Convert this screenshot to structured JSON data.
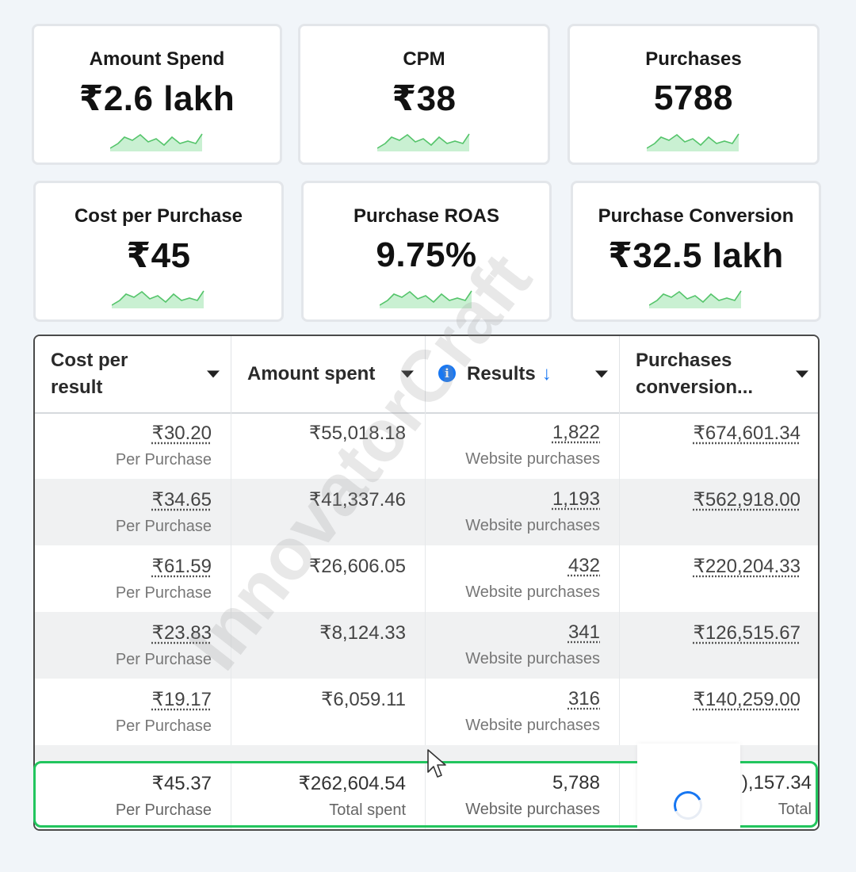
{
  "cards": [
    {
      "title": "Amount Spend",
      "value": "₹2.6 lakh"
    },
    {
      "title": "CPM",
      "value": "₹38"
    },
    {
      "title": "Purchases",
      "value": "5788"
    },
    {
      "title": "Cost per Purchase",
      "value": "₹45"
    },
    {
      "title": "Purchase ROAS",
      "value": "9.75%"
    },
    {
      "title": "Purchase Conversion",
      "value": "₹32.5 lakh"
    }
  ],
  "table": {
    "columns": [
      {
        "label": "Cost per result"
      },
      {
        "label": "Amount spent"
      },
      {
        "label": "Results",
        "sort_icon": "↓"
      },
      {
        "label": "Purchases conversion..."
      }
    ],
    "rows": [
      {
        "cost": "₹30.20",
        "cost_sub": "Per Purchase",
        "spent": "₹55,018.18",
        "results": "1,822",
        "results_sub": "Website purchases",
        "conv": "₹674,601.34"
      },
      {
        "cost": "₹34.65",
        "cost_sub": "Per Purchase",
        "spent": "₹41,337.46",
        "results": "1,193",
        "results_sub": "Website purchases",
        "conv": "₹562,918.00"
      },
      {
        "cost": "₹61.59",
        "cost_sub": "Per Purchase",
        "spent": "₹26,606.05",
        "results": "432",
        "results_sub": "Website purchases",
        "conv": "₹220,204.33"
      },
      {
        "cost": "₹23.83",
        "cost_sub": "Per Purchase",
        "spent": "₹8,124.33",
        "results": "341",
        "results_sub": "Website purchases",
        "conv": "₹126,515.67"
      },
      {
        "cost": "₹19.17",
        "cost_sub": "Per Purchase",
        "spent": "₹6,059.11",
        "results": "316",
        "results_sub": "Website purchases",
        "conv": "₹140,259.00"
      }
    ],
    "totals": {
      "cost": "₹45.37",
      "cost_sub": "Per Purchase",
      "spent": "₹262,604.54",
      "spent_sub": "Total spent",
      "results": "5,788",
      "results_sub": "Website purchases",
      "conv": "),157.34",
      "conv_sub": "Total"
    }
  },
  "watermark": "InnovatorCraft",
  "colors": {
    "accent": "#1877f2",
    "highlight": "#22c55e",
    "spark_fill": "#c9f0d2",
    "spark_line": "#54c46a"
  },
  "icons": {
    "info": "info-icon",
    "sort": "arrow-down-icon",
    "caret": "caret-down-icon",
    "cursor": "mouse-pointer-icon",
    "loader": "spinner-icon"
  }
}
